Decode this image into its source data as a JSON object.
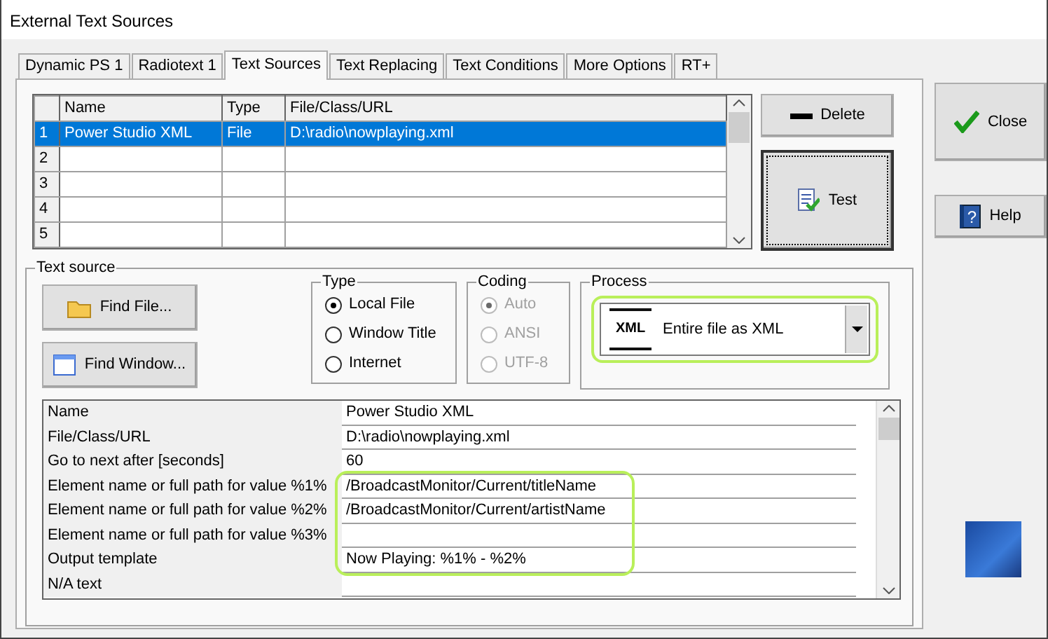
{
  "window": {
    "title": "External Text Sources"
  },
  "tabs": [
    {
      "label": "Dynamic PS 1",
      "selected": false
    },
    {
      "label": "Radiotext 1",
      "selected": false
    },
    {
      "label": "Text Sources",
      "selected": true
    },
    {
      "label": "Text Replacing",
      "selected": false
    },
    {
      "label": "Text Conditions",
      "selected": false
    },
    {
      "label": "More Options",
      "selected": false
    },
    {
      "label": "RT+",
      "selected": false
    }
  ],
  "sources_table": {
    "columns": [
      "Name",
      "Type",
      "File/Class/URL"
    ],
    "rows": [
      {
        "number": "1",
        "cells": [
          "Power Studio XML",
          "File",
          "D:\\radio\\nowplaying.xml"
        ],
        "selected": true
      },
      {
        "number": "2",
        "cells": [],
        "selected": false
      },
      {
        "number": "3",
        "cells": [],
        "selected": false
      },
      {
        "number": "4",
        "cells": [],
        "selected": false
      },
      {
        "number": "5",
        "cells": [],
        "selected": false
      }
    ]
  },
  "table_buttons": [
    {
      "label": "Delete",
      "kind": "delete",
      "focused": false
    },
    {
      "label": "Test",
      "kind": "test",
      "focused": true
    }
  ],
  "side_buttons": [
    {
      "label": "Close",
      "kind": "close"
    },
    {
      "label": "Help",
      "kind": "help",
      "icon_text": "?"
    }
  ],
  "text_source": {
    "title": "Text source",
    "buttons": [
      {
        "label": "Find File...",
        "kind": "folder"
      },
      {
        "label": "Find Window...",
        "kind": "window"
      }
    ],
    "type_group": {
      "title": "Type",
      "disabled": false,
      "options": [
        {
          "label": "Local File",
          "selected": true
        },
        {
          "label": "Window Title",
          "selected": false
        },
        {
          "label": "Internet",
          "selected": false
        }
      ]
    },
    "coding_group": {
      "title": "Coding",
      "disabled": true,
      "options": [
        {
          "label": "Auto",
          "selected": true
        },
        {
          "label": "ANSI",
          "selected": false
        },
        {
          "label": "UTF-8",
          "selected": false
        }
      ]
    },
    "process": {
      "title": "Process",
      "icon_text": "XML",
      "value": "Entire file as XML",
      "highlighted": true
    },
    "properties": [
      {
        "label": "Name",
        "value": "Power Studio XML",
        "highlighted": false
      },
      {
        "label": "File/Class/URL",
        "value": "D:\\radio\\nowplaying.xml",
        "highlighted": false
      },
      {
        "label": "Go to next after [seconds]",
        "value": "60",
        "highlighted": false
      },
      {
        "label": "Element name or full path for value %1%",
        "value": "/BroadcastMonitor/Current/titleName",
        "highlighted": true
      },
      {
        "label": "Element name or full path for value %2%",
        "value": "/BroadcastMonitor/Current/artistName",
        "highlighted": true
      },
      {
        "label": "Element name or full path for value %3%",
        "highlighted": true
      },
      {
        "label": "Output template",
        "value": "Now Playing: %1% - %2%",
        "highlighted": true
      },
      {
        "label": "N/A text",
        "highlighted": false
      }
    ]
  }
}
